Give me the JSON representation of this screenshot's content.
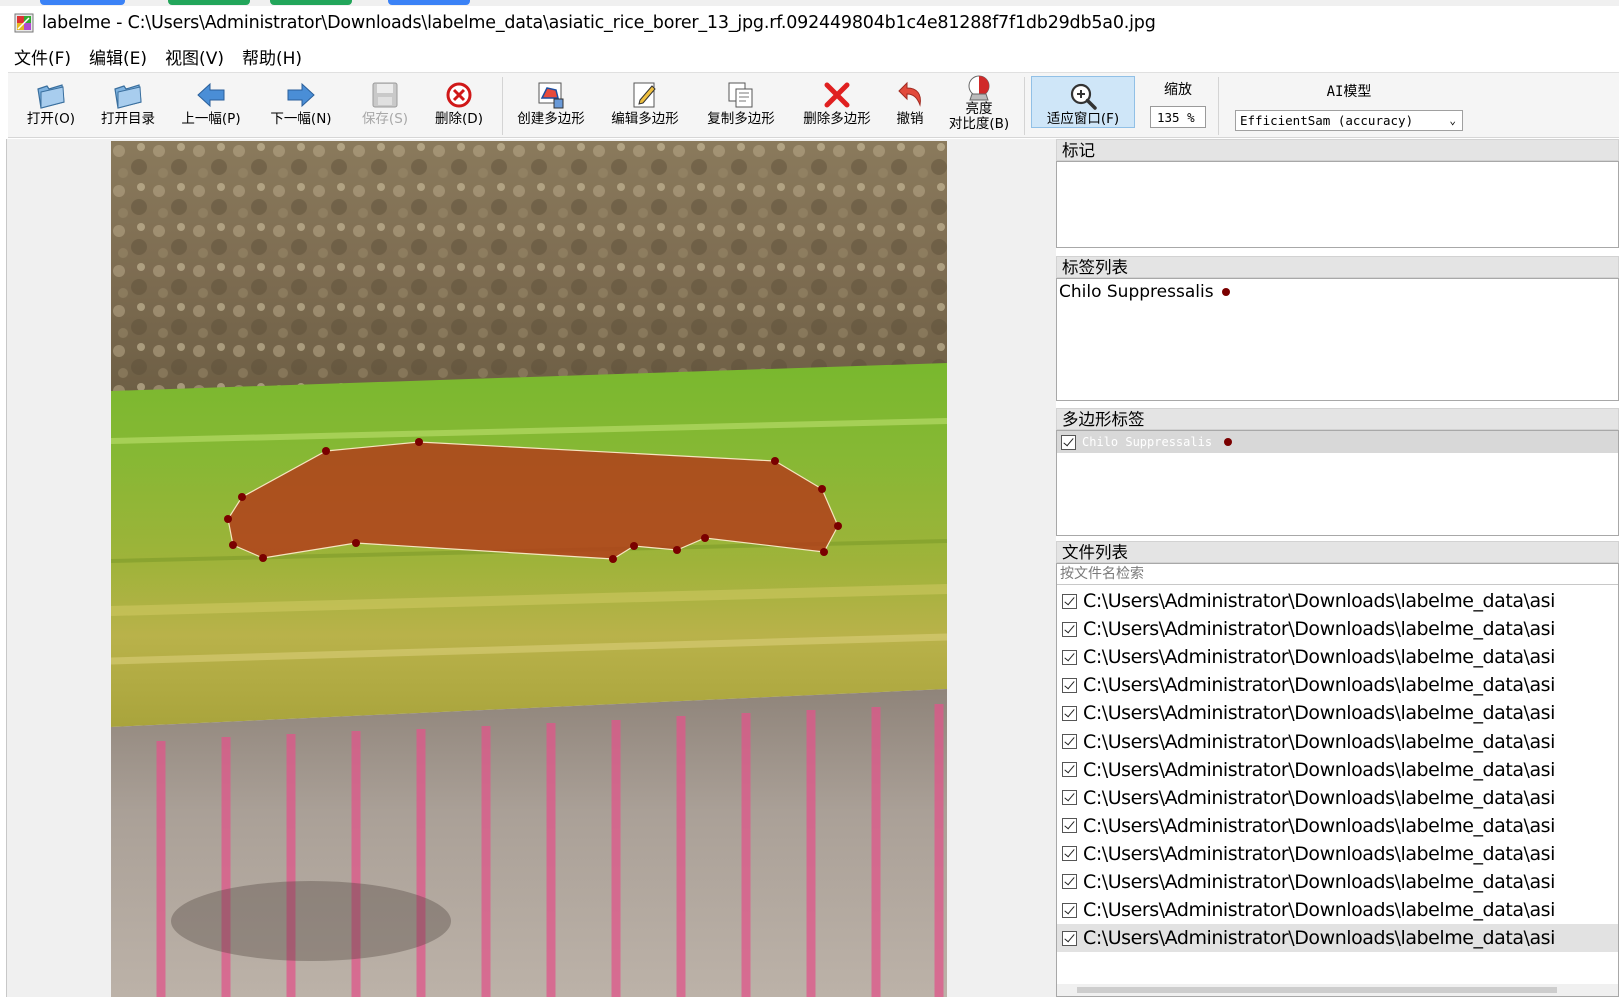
{
  "window": {
    "title": "labelme - C:\\Users\\Administrator\\Downloads\\labelme_data\\asiatic_rice_borer_13_jpg.rf.092449804b1c4e81288f7f1db29db5a0.jpg"
  },
  "menu": [
    "文件(F)",
    "编辑(E)",
    "视图(V)",
    "帮助(H)"
  ],
  "toolbar": {
    "open": "打开(O)",
    "open_dir": "打开目录",
    "prev": "上一幅(P)",
    "next": "下一幅(N)",
    "save": "保存(S)",
    "delete_file": "删除(D)",
    "create_polygon": "创建多边形",
    "edit_polygon": "编辑多边形",
    "duplicate_polygon": "复制多边形",
    "delete_polygon": "删除多边形",
    "undo": "撤销",
    "brightness_line1": "亮度",
    "brightness_line2": "对比度(B)",
    "fit_window": "适应窗口(F)",
    "zoom_title": "缩放",
    "zoom_value": "135 %",
    "ai_title": "AI模型",
    "ai_model": "EfficientSam (accuracy)"
  },
  "colors": {
    "polygon_fill": "#b23a1a",
    "polygon_vertex": "#7a0000",
    "label_dot": "#7a0000",
    "active_tool_bg": "#cfe6f8"
  },
  "panels": {
    "flags": {
      "title": "标记"
    },
    "label_list": {
      "title": "标签列表",
      "items": [
        {
          "label": "Chilo Suppressalis"
        }
      ]
    },
    "polygon_labels": {
      "title": "多边形标签",
      "items": [
        {
          "label": "Chilo Suppressalis",
          "checked": true
        }
      ]
    },
    "file_list": {
      "title": "文件列表",
      "search_placeholder": "按文件名检索",
      "items": [
        "C:\\Users\\Administrator\\Downloads\\labelme_data\\asi",
        "C:\\Users\\Administrator\\Downloads\\labelme_data\\asi",
        "C:\\Users\\Administrator\\Downloads\\labelme_data\\asi",
        "C:\\Users\\Administrator\\Downloads\\labelme_data\\asi",
        "C:\\Users\\Administrator\\Downloads\\labelme_data\\asi",
        "C:\\Users\\Administrator\\Downloads\\labelme_data\\asi",
        "C:\\Users\\Administrator\\Downloads\\labelme_data\\asi",
        "C:\\Users\\Administrator\\Downloads\\labelme_data\\asi",
        "C:\\Users\\Administrator\\Downloads\\labelme_data\\asi",
        "C:\\Users\\Administrator\\Downloads\\labelme_data\\asi",
        "C:\\Users\\Administrator\\Downloads\\labelme_data\\asi",
        "C:\\Users\\Administrator\\Downloads\\labelme_data\\asi",
        "C:\\Users\\Administrator\\Downloads\\labelme_data\\asi"
      ],
      "selected_index": 12
    }
  }
}
